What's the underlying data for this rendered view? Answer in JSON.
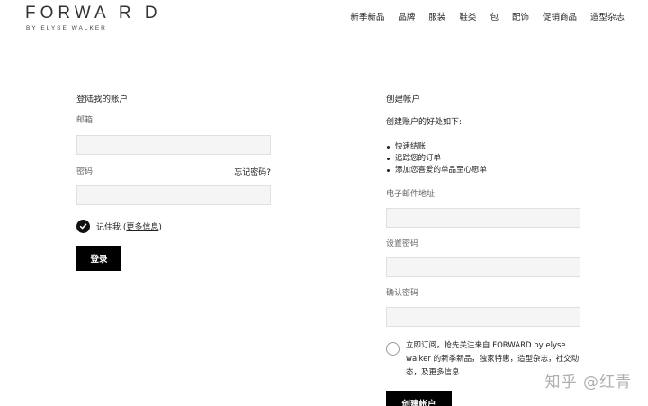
{
  "brand": {
    "name": "FORWA R D",
    "tagline": "BY ELYSE WALKER"
  },
  "nav": [
    "新季新品",
    "品牌",
    "服装",
    "鞋类",
    "包",
    "配饰",
    "促销商品",
    "造型杂志"
  ],
  "login": {
    "title": "登陆我的账户",
    "email_label": "邮箱",
    "email_value": "",
    "password_label": "密码",
    "password_value": "",
    "forgot_link": "忘记密码?",
    "remember_text": "记住我 (",
    "more_info": "更多信息",
    "remember_close": ")",
    "submit_label": "登录",
    "remember_checked": true
  },
  "register": {
    "title": "创建帐户",
    "intro": "创建账户的好处如下:",
    "benefits": [
      "快速结账",
      "追踪您的订单",
      "添加您喜爱的单品至心愿单"
    ],
    "email_label": "电子邮件地址",
    "email_value": "",
    "password_label": "设置密码",
    "password_value": "",
    "confirm_label": "确认密码",
    "confirm_value": "",
    "newsletter_text": "立即订阅，抢先关注来自 FORWARD by elyse walker 的新季新品，独家特惠，造型杂志，社交动态，及更多信息",
    "newsletter_checked": false,
    "submit_label": "创建帐户"
  },
  "watermark": "知乎 @红青",
  "colors": {
    "button_bg": "#000000",
    "input_bg": "#f5f5f5",
    "text": "#222222"
  }
}
